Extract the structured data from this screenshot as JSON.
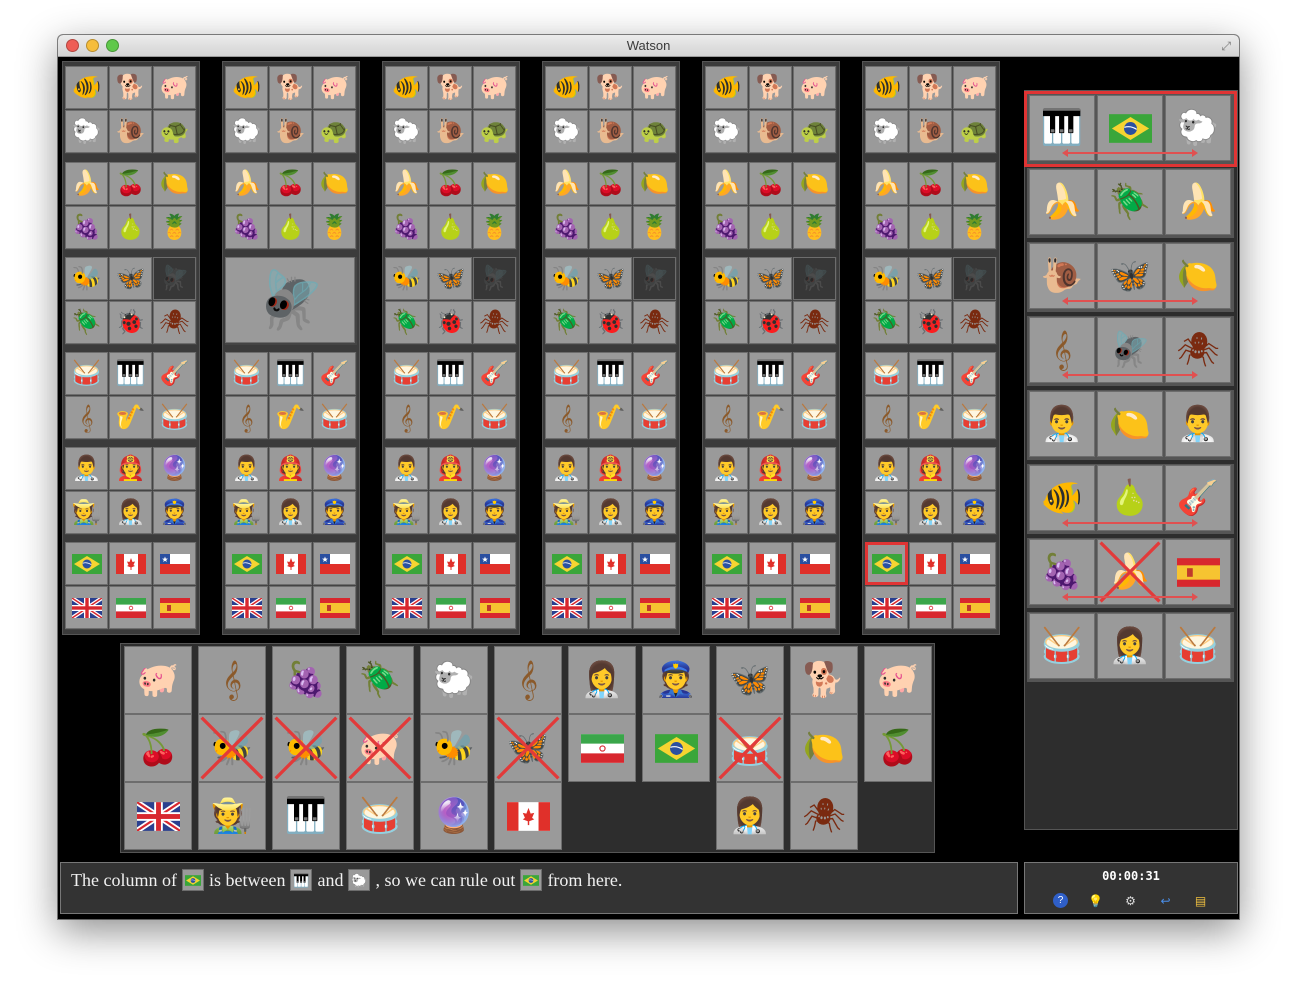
{
  "window": {
    "title": "Watson"
  },
  "categories": {
    "animals": [
      "fish",
      "dog",
      "pig",
      "sheep",
      "snail",
      "turtle"
    ],
    "fruits": [
      "banana",
      "cherry",
      "lemon",
      "grape",
      "pear",
      "pineapple"
    ],
    "bugs": [
      "bee",
      "butterfly",
      "fly",
      "beetle",
      "ladybug",
      "tick"
    ],
    "instruments": [
      "drum",
      "piano",
      "guitar",
      "harp",
      "saxophone",
      "snare"
    ],
    "people": [
      "doctor",
      "firefighter",
      "fortune-teller",
      "farmer",
      "nurse",
      "police"
    ],
    "flags": [
      "brazil",
      "canada",
      "chile",
      "uk",
      "iran",
      "spain"
    ]
  },
  "grid_state": {
    "column_2_bugs_solved": "fly",
    "dimmed_fly_in_columns": [
      1,
      3,
      4,
      5,
      6
    ],
    "highlighted_cell": {
      "column": 6,
      "category": "flags",
      "item": "brazil"
    }
  },
  "vertical_clues": [
    {
      "items": [
        "piano",
        "brazil",
        "sheep"
      ],
      "arrow": true,
      "active": true
    },
    {
      "items": [
        "banana",
        "beetle",
        "banana"
      ],
      "arrow": false
    },
    {
      "items": [
        "snail",
        "butterfly",
        "lemon"
      ],
      "arrow": true
    },
    {
      "items": [
        "harp",
        "fly",
        "tick"
      ],
      "arrow": true
    },
    {
      "items": [
        "doctor",
        "lemon",
        "doctor"
      ],
      "arrow": false
    },
    {
      "items": [
        "fish",
        "pear",
        "guitar"
      ],
      "arrow": true
    },
    {
      "items": [
        "grape",
        "banana",
        "spain"
      ],
      "arrow": true,
      "crossed": [
        1
      ]
    },
    {
      "items": [
        "snare",
        "nurse",
        "snare"
      ],
      "arrow": false
    }
  ],
  "horizontal_clues": [
    {
      "top": "pig",
      "bottom": "cherry",
      "extra": "uk"
    },
    {
      "top": "harp",
      "bottom": "bee",
      "extra": "farmer",
      "crossed": [
        "bottom"
      ]
    },
    {
      "top": "grape",
      "bottom": "bee",
      "extra": "piano",
      "crossed": [
        "bottom"
      ]
    },
    {
      "top": "beetle",
      "bottom": "pig",
      "extra": "snare",
      "crossed": [
        "bottom"
      ]
    },
    {
      "top": "sheep",
      "bottom": "bee",
      "extra": "fortune-teller"
    },
    {
      "top": "harp",
      "bottom": "butterfly",
      "extra": "canada",
      "crossed": [
        "bottom"
      ]
    },
    {
      "top": "nurse",
      "bottom": "iran"
    },
    {
      "top": "police",
      "bottom": "brazil"
    },
    {
      "top": "butterfly",
      "bottom": "snare",
      "extra": "nurse",
      "crossed": [
        "bottom"
      ]
    },
    {
      "top": "dog",
      "bottom": "lemon",
      "extra": "tick"
    },
    {
      "top": "pig",
      "bottom": "cherry"
    }
  ],
  "message": {
    "part1": "The column of",
    "part2": "is between",
    "part3": "and",
    "part4": ", so we can rule out",
    "part5": "from here."
  },
  "status": {
    "timer": "00:00:31"
  },
  "toolbar": [
    "help-icon",
    "hint-icon",
    "settings-icon",
    "undo-icon",
    "window-icon"
  ],
  "colors": {
    "highlight": "#e03434",
    "cell": "#9a9a9a",
    "panel": "#2d2d2d"
  }
}
